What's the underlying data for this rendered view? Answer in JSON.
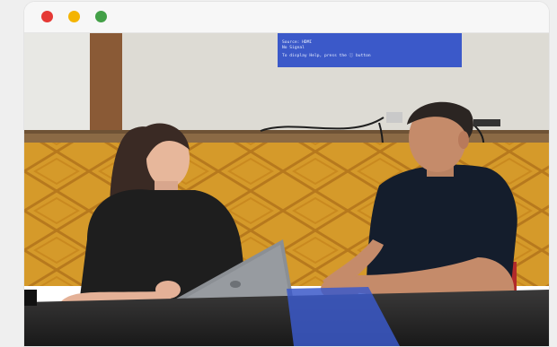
{
  "window": {
    "controls": [
      {
        "name": "close",
        "color": "#e53935"
      },
      {
        "name": "minimize",
        "color": "#f4b400"
      },
      {
        "name": "maximize",
        "color": "#43a047"
      }
    ]
  },
  "photo": {
    "projector": {
      "line1": "Source: HDMI",
      "line2": "No Signal",
      "line3": "To display Help, press the ⓘ button"
    },
    "colors": {
      "wall": "#dddbd4",
      "wood_panel": "#d59a2a",
      "table": "#2b2a2a",
      "laptop": "#8b8f94",
      "projection": "#3b59c9"
    }
  }
}
